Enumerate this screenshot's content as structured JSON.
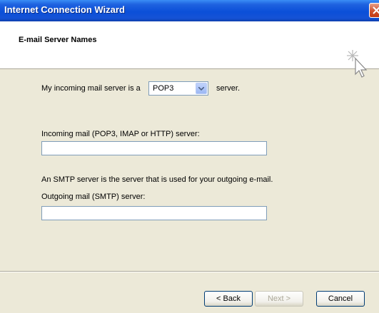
{
  "window": {
    "title": "Internet Connection Wizard"
  },
  "header": {
    "title": "E-mail Server Names"
  },
  "form": {
    "incoming_prefix": "My incoming mail server is a",
    "server_type_value": "POP3",
    "incoming_suffix": "server.",
    "incoming_label": "Incoming mail (POP3, IMAP or HTTP) server:",
    "incoming_value": "",
    "smtp_note": "An SMTP server is the server that is used for your outgoing e-mail.",
    "outgoing_label": "Outgoing mail (SMTP) server:",
    "outgoing_value": ""
  },
  "buttons": {
    "back": "< Back",
    "next": "Next >",
    "cancel": "Cancel"
  },
  "colors": {
    "titlebar": "#0b4fd8",
    "dialog_bg": "#ece9d8",
    "close_button": "#d0512c"
  },
  "icons": {
    "close": "close-icon",
    "wizard": "wizard-cursor-icon",
    "dropdown": "chevron-down-icon"
  }
}
